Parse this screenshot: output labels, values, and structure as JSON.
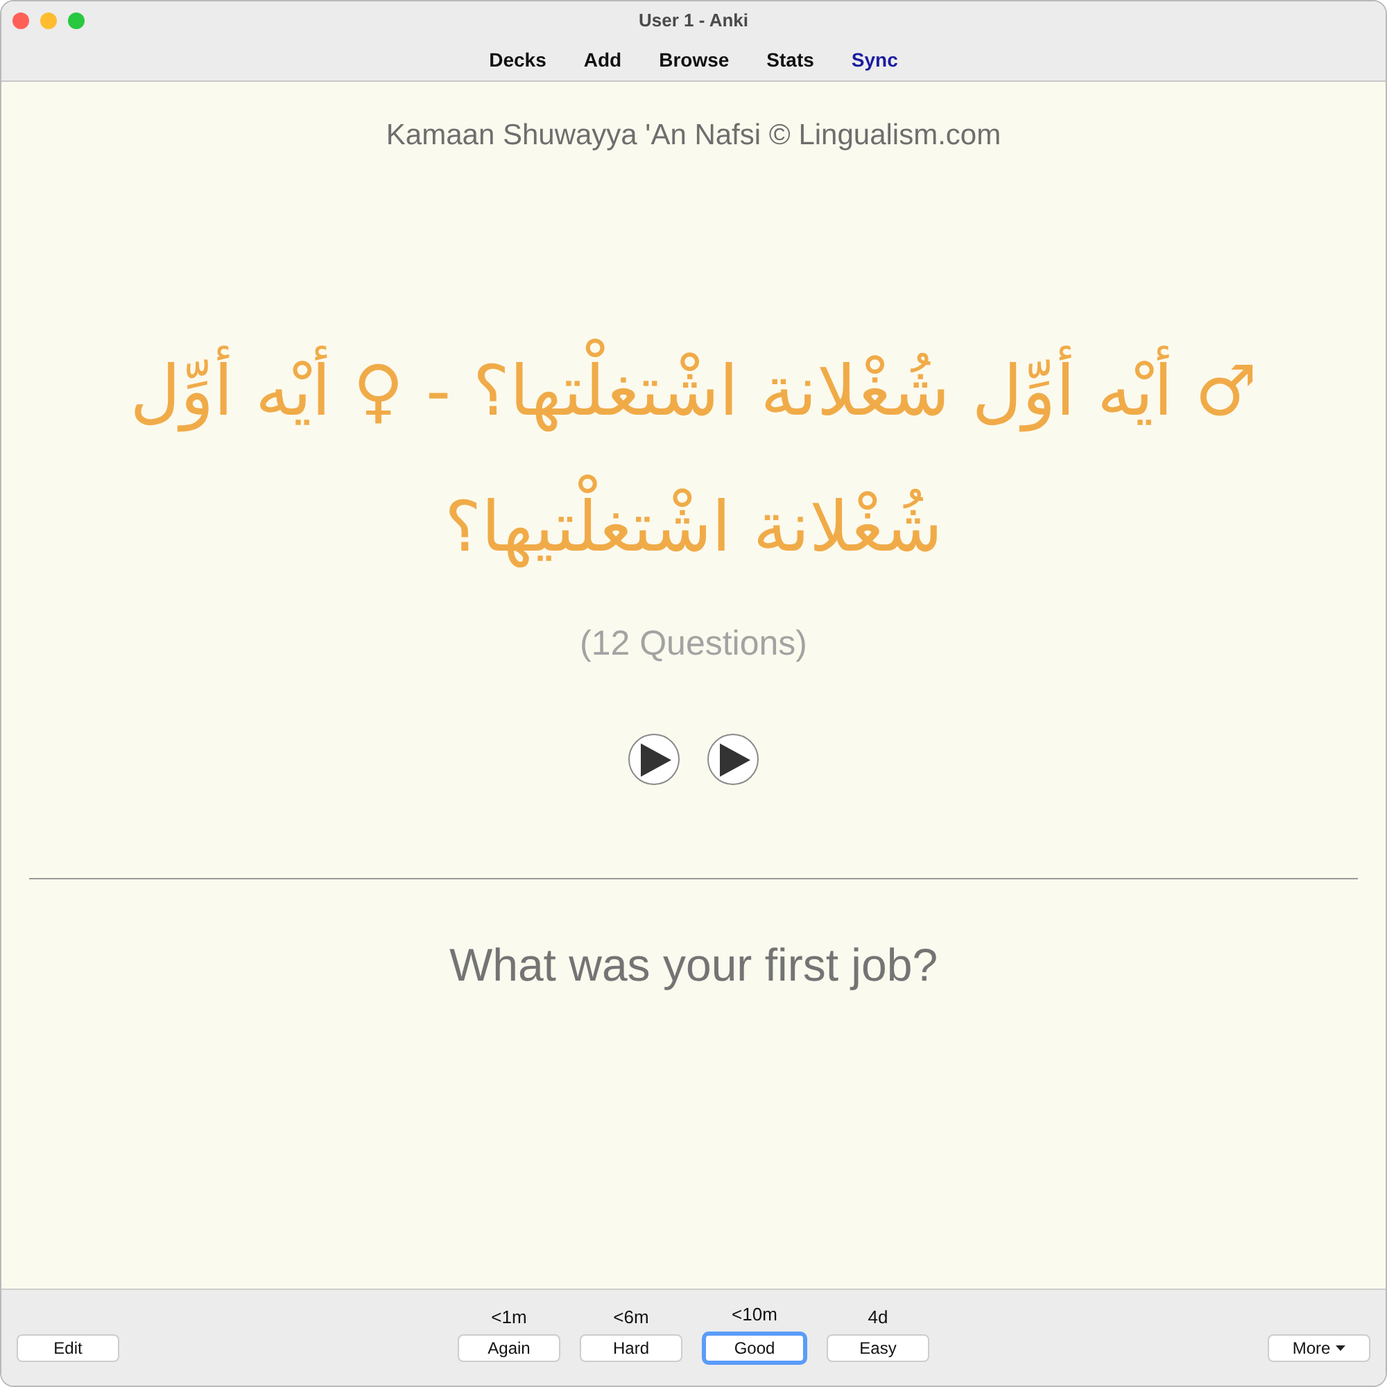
{
  "window": {
    "title": "User 1 - Anki"
  },
  "toolbar": [
    {
      "label": "Decks",
      "highlighted": false
    },
    {
      "label": "Add",
      "highlighted": false
    },
    {
      "label": "Browse",
      "highlighted": false
    },
    {
      "label": "Stats",
      "highlighted": false
    },
    {
      "label": "Sync",
      "highlighted": true
    }
  ],
  "card": {
    "deck_title": "Kamaan Shuwayya 'An Nafsi © Lingualism.com",
    "question": "♂ أيْه أوِّل شُغْلانة اشْتغلْتها؟ - ♀ أيْه أوِّل شُغْلانة اشْتغلْتيها؟",
    "count": "(12 Questions)",
    "audio_buttons": [
      {
        "kind": "play"
      },
      {
        "kind": "play"
      }
    ],
    "answer": "What was your first job?"
  },
  "bottom_bar": {
    "edit": "Edit",
    "answers": [
      {
        "interval": "<1m",
        "label": "Again",
        "focused": false
      },
      {
        "interval": "<6m",
        "label": "Hard",
        "focused": false
      },
      {
        "interval": "<10m",
        "label": "Good",
        "focused": true
      },
      {
        "interval": "4d",
        "label": "Easy",
        "focused": false
      }
    ],
    "more": "More"
  }
}
